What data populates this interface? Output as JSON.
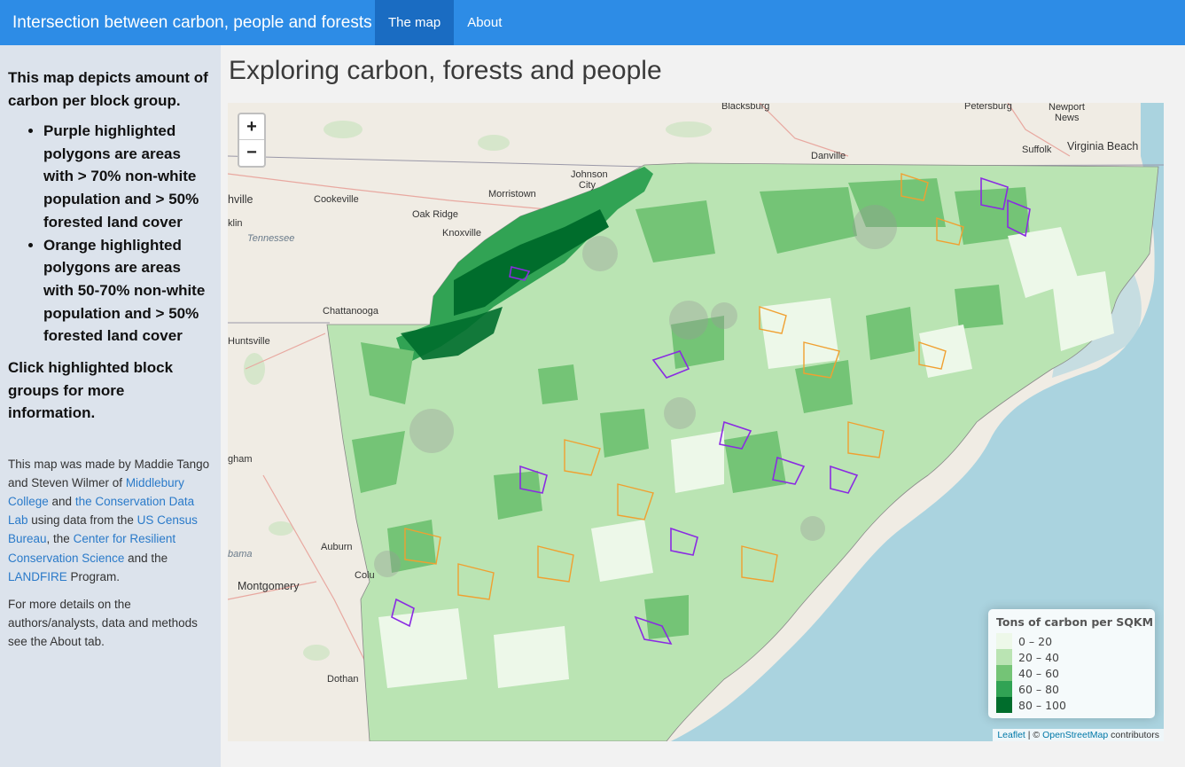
{
  "navbar": {
    "title": "Intersection between carbon, people and forests",
    "tabs": [
      {
        "label": "The map",
        "active": true
      },
      {
        "label": "About",
        "active": false
      }
    ]
  },
  "sidebar": {
    "lead": "This map depicts amount of carbon per block group.",
    "bullets": [
      "Purple highlighted polygons are areas with > 70% non-white population and > 50% forested land cover",
      "Orange highlighted polygons are areas with 50-70% non-white population and > 50% forested land cover"
    ],
    "click_hint": "Click highlighted block groups for more information.",
    "credit": {
      "t1": "This map was made by Maddie Tango and Steven Wilmer of ",
      "link1": "Middlebury College",
      "t2": " and ",
      "link2": "the Conservation Data Lab",
      "t3": " using data from the ",
      "link3": "US Census Bureau",
      "t4": ", the ",
      "link4": "Center for Resilient Conservation Science",
      "t5": " and the ",
      "link5": "LANDFIRE",
      "t6": " Program."
    },
    "more": "For more details on the authors/analysts, data and methods see the About tab."
  },
  "main": {
    "title": "Exploring carbon, forests and people"
  },
  "map": {
    "zoom_in": "+",
    "zoom_out": "−",
    "places": {
      "blacksburg": "Blacksburg",
      "petersburg": "Petersburg",
      "newport1": "Newport",
      "newport2": "News",
      "virginia_beach": "Virginia Beach",
      "suffolk": "Suffolk",
      "danville": "Danville",
      "johnson1": "Johnson",
      "johnson2": "City",
      "morristown": "Morristown",
      "cookeville": "Cookeville",
      "oak_ridge": "Oak Ridge",
      "knoxville": "Knoxville",
      "nville": "hville",
      "klin": "klin",
      "tennessee": "Tennessee",
      "chattanooga": "Chattanooga",
      "huntsville": "Huntsville",
      "gham": "gham",
      "bama": "bama",
      "auburn": "Auburn",
      "colu": "Colu",
      "montgomery": "Montgomery",
      "dothan": "Dothan"
    },
    "attribution": {
      "leaflet": "Leaflet",
      "sep": " | © ",
      "osm": "OpenStreetMap",
      "rest": " contributors"
    }
  },
  "legend": {
    "title": "Tons of carbon per SQKM",
    "items": [
      {
        "label": "0 – 20",
        "color": "#edf8e9"
      },
      {
        "label": "20 – 40",
        "color": "#bae4b3"
      },
      {
        "label": "40 – 60",
        "color": "#74c476"
      },
      {
        "label": "60 – 80",
        "color": "#31a354"
      },
      {
        "label": "80 – 100",
        "color": "#006d2c"
      }
    ]
  },
  "colors": {
    "navbar": "#2d8ce6",
    "nav_active": "#1a6cc2",
    "water": "#aad3df",
    "purple_highlight": "#8a2be2",
    "orange_highlight": "#f0a030"
  }
}
